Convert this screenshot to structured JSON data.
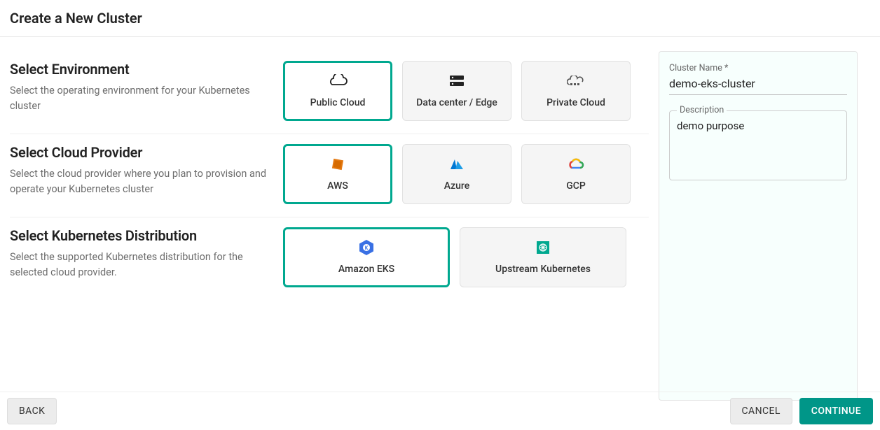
{
  "page_title": "Create a New Cluster",
  "sections": {
    "environment": {
      "title": "Select Environment",
      "desc": "Select the operating environment for your Kubernetes cluster",
      "options": {
        "public_cloud": "Public Cloud",
        "data_center": "Data center / Edge",
        "private_cloud": "Private Cloud"
      }
    },
    "provider": {
      "title": "Select Cloud Provider",
      "desc": "Select the cloud provider where you plan to provision and operate your Kubernetes cluster",
      "options": {
        "aws": "AWS",
        "azure": "Azure",
        "gcp": "GCP"
      }
    },
    "distribution": {
      "title": "Select Kubernetes Distribution",
      "desc": "Select the supported Kubernetes distribution for the selected cloud provider.",
      "options": {
        "eks": "Amazon EKS",
        "upstream": "Upstream Kubernetes"
      }
    }
  },
  "form": {
    "cluster_name_label": "Cluster Name *",
    "cluster_name_value": "demo-eks-cluster",
    "description_label": "Description",
    "description_value": "demo purpose"
  },
  "buttons": {
    "back": "BACK",
    "cancel": "CANCEL",
    "continue": "CONTINUE"
  }
}
